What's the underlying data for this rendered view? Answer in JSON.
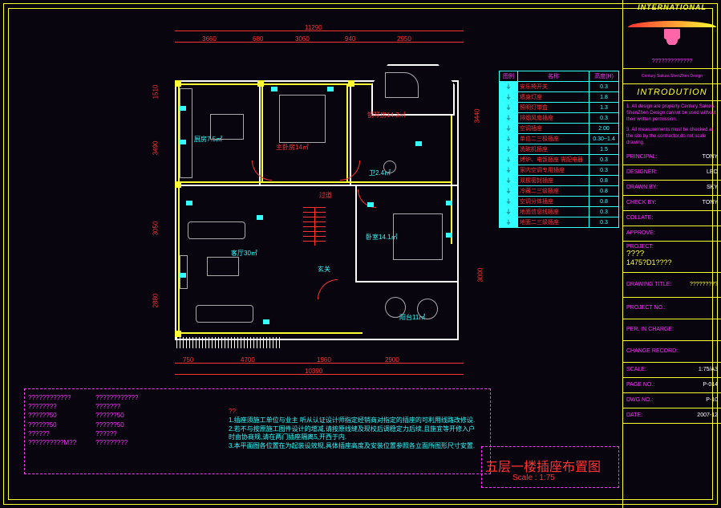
{
  "frame": {
    "title_intl": "INTERNATIONAL"
  },
  "dims_top_total": "11290",
  "dims_top": [
    "3660",
    "680",
    "3060",
    "940",
    "2950"
  ],
  "dims_left": [
    "1510",
    "3490",
    "3050",
    "2880"
  ],
  "dims_right": [
    "3440",
    "3000"
  ],
  "dims_bot_total": "10390",
  "dims_bot": [
    "750",
    "4700",
    "1960",
    "2900"
  ],
  "rooms": {
    "kitchen": "厨房7.5㎡",
    "bedroom1": "主卧房14㎡",
    "piano": "钢琴房14.3㎡",
    "wc": "卫2.4㎡",
    "corridor": "过道",
    "living": "客厅30㎡",
    "bedroom2": "卧室14.1㎡",
    "entry": "玄关",
    "balcony": "阳台11㎡"
  },
  "legend": {
    "header": [
      "图例",
      "名称",
      "高度(H)"
    ],
    "rows": [
      {
        "name": "安乐椅开关",
        "ht": "0.3"
      },
      {
        "name": "墙身灯座",
        "ht": "1.8"
      },
      {
        "name": "照明灯带盒",
        "ht": "1.3"
      },
      {
        "name": "排烟风扇插座",
        "ht": "0.3"
      },
      {
        "name": "空调插座",
        "ht": "2.00"
      },
      {
        "name": "单位二三极插座",
        "ht": "0.30~1.4"
      },
      {
        "name": "洗碗机插座",
        "ht": "1.5"
      },
      {
        "name": "烤炉、电饭插座 需配电器",
        "ht": "0.3"
      },
      {
        "name": "家内空调专用插座",
        "ht": "0.3"
      },
      {
        "name": "双极密封插座",
        "ht": "0.8"
      },
      {
        "name": "冷藏二三级插座",
        "ht": "0.8"
      },
      {
        "name": "空调分体插座",
        "ht": "0.8"
      },
      {
        "name": "地面信息线插座",
        "ht": "0.3"
      },
      {
        "name": "地面二三级插座",
        "ht": "0.3"
      }
    ]
  },
  "titleblock": {
    "company_sub": "?????????????",
    "company_en": "Century Sakura ShenZhen Design",
    "intro_title": "INTRODUTION",
    "intro_1": "1. All design are property Century Sakura ShenZhen Design cannot be used without their written permission.",
    "intro_3": "3. All measurements must be checked at the site by the contractor,do not scale drawing.",
    "rows": [
      {
        "k": "PRINCIPAL:",
        "v": "TONY"
      },
      {
        "k": "DESIGNER:",
        "v": "LEO"
      },
      {
        "k": "DRAWN BY:",
        "v": "SKY"
      },
      {
        "k": "CHECK BY:",
        "v": "TONY"
      },
      {
        "k": "COLLATE:",
        "v": ""
      },
      {
        "k": "APPROVE:",
        "v": ""
      }
    ],
    "project_k": "PROJECT:",
    "project_v1": "????",
    "project_v2": "1475?D1????",
    "dwg_title_k": "DRAWING TITLE:",
    "dwg_title_v": "?????????",
    "project_no_k": "PROJECT NO.:",
    "per_in_charge_k": "PER. IN CHARGE:",
    "change_rec_k": "CHANGE RECORD:",
    "scale_k": "SCALE:",
    "scale_v": "1:75/A3",
    "page_k": "PAGE NO.:",
    "page_v": "P-014",
    "dwg_k": "DWG NO.:",
    "dwg_v": "P-10",
    "date_k": "DATE:",
    "date_v": "2007-12"
  },
  "notes_left": [
    "????????????",
    "????????",
    "??????50",
    "??????50",
    "??????",
    "??????????M??"
  ],
  "notes_left2": [
    "????????????",
    "???????",
    "??????50",
    "??????50",
    "??????",
    "?????????"
  ],
  "notes_right_lead": "??:",
  "notes_right": [
    "1.插座须施工单位与业主 听从认证设计师指定经销商对指定的插座的可利用线路改修设.",
    "2.若不与按原施工图件设计的增减,请按原线缝及现校后调稳定力后续,且施宜等开修入户时由协商规,请在两门插座隔离5,开西于内.",
    "3.本平面图各位置在为起装设效规,具体插座高度及安装位置参照各立面所图形尺寸安置."
  ],
  "bigtitle": "五层一楼插座布置图",
  "bigscale": "Scale : 1:75"
}
